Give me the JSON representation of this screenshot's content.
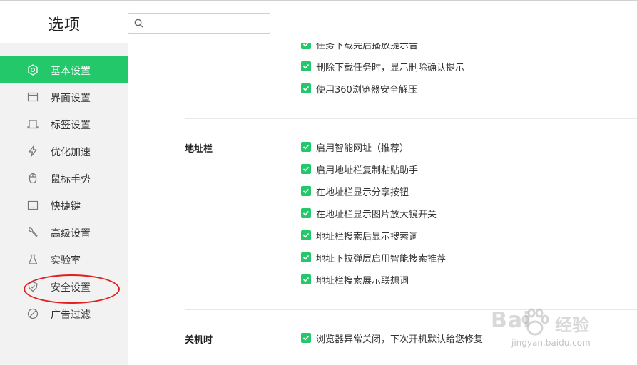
{
  "header": {
    "title": "选项",
    "search_placeholder": ""
  },
  "sidebar": {
    "items": [
      {
        "label": "基本设置",
        "icon": "gear-icon",
        "active": true
      },
      {
        "label": "界面设置",
        "icon": "window-icon",
        "active": false
      },
      {
        "label": "标签设置",
        "icon": "tab-icon",
        "active": false
      },
      {
        "label": "优化加速",
        "icon": "lightning-icon",
        "active": false
      },
      {
        "label": "鼠标手势",
        "icon": "mouse-icon",
        "active": false
      },
      {
        "label": "快捷键",
        "icon": "keyboard-icon",
        "active": false
      },
      {
        "label": "高级设置",
        "icon": "wrench-icon",
        "active": false
      },
      {
        "label": "实验室",
        "icon": "flask-icon",
        "active": false
      },
      {
        "label": "安全设置",
        "icon": "shield-icon",
        "active": false
      },
      {
        "label": "广告过滤",
        "icon": "block-icon",
        "active": false
      }
    ]
  },
  "download_section": {
    "options": [
      {
        "label": "任务下载完后播放提示音",
        "checked": true
      },
      {
        "label": "删除下载任务时，显示删除确认提示",
        "checked": true
      },
      {
        "label": "使用360浏览器安全解压",
        "checked": true
      }
    ]
  },
  "address_bar": {
    "title": "地址栏",
    "options": [
      {
        "label": "启用智能网址（推荐）",
        "checked": true
      },
      {
        "label": "启用地址栏复制粘贴助手",
        "checked": true
      },
      {
        "label": "在地址栏显示分享按钮",
        "checked": true
      },
      {
        "label": "在地址栏显示图片放大镜开关",
        "checked": true
      },
      {
        "label": "地址栏搜索后显示搜索词",
        "checked": true
      },
      {
        "label": "地址下拉弹层启用智能搜索推荐",
        "checked": true
      },
      {
        "label": "地址栏搜索展示联想词",
        "checked": true
      }
    ]
  },
  "shutdown": {
    "title": "关机时",
    "options": [
      {
        "label": "浏览器异常关闭，下次开机默认给您修复",
        "checked": true
      }
    ]
  },
  "watermark": {
    "brand": "Bai",
    "cn": "经验",
    "url": "jingyan.baidu.com"
  },
  "colors": {
    "accent": "#23c86a",
    "highlight_circle": "#e02020",
    "sidebar_bg": "#f2f2f2"
  }
}
